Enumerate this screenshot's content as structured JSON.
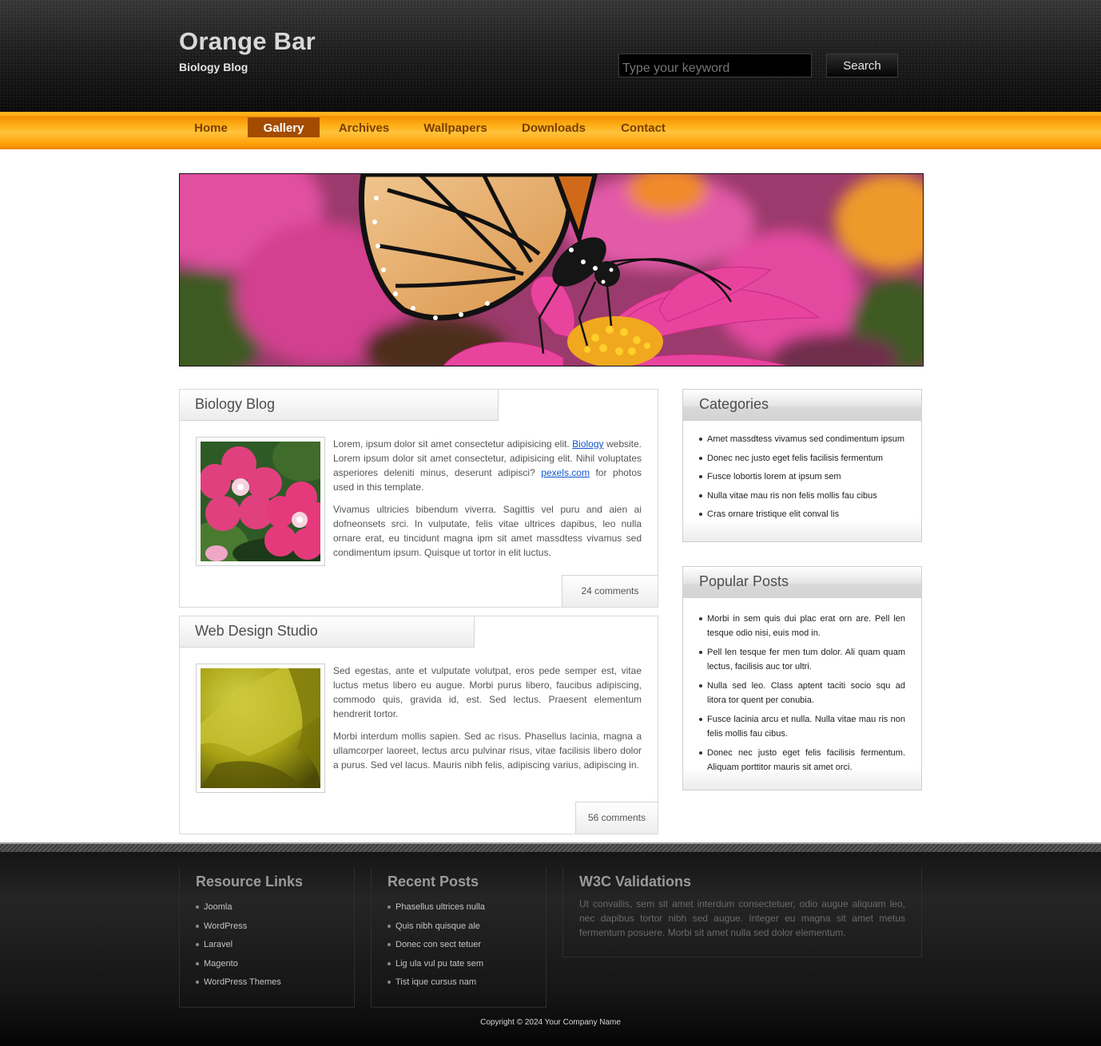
{
  "header": {
    "site_title": "Orange Bar",
    "tagline": "Biology Blog",
    "search_placeholder": "Type your keyword",
    "search_button": "Search"
  },
  "nav": {
    "items": [
      {
        "label": "Home",
        "active": false
      },
      {
        "label": "Gallery",
        "active": true
      },
      {
        "label": "Archives",
        "active": false
      },
      {
        "label": "Wallpapers",
        "active": false
      },
      {
        "label": "Downloads",
        "active": false
      },
      {
        "label": "Contact",
        "active": false
      }
    ]
  },
  "posts": [
    {
      "title": "Biology Blog",
      "p1_before": "Lorem, ipsum dolor sit amet consectetur adipisicing elit. ",
      "link1": "Biology",
      "p1_middle": " website. Lorem ipsum dolor sit amet consectetur, adipisicing elit. Nihil voluptates asperiores deleniti minus, deserunt adipisci? ",
      "link2": "pexels.com",
      "p1_after": " for photos used in this template.",
      "p2": "Vivamus ultricies bibendum viverra. Sagittis vel puru and aien ai dofneonsets srci. In vulputate, felis vitae ultrices dapibus, leo nulla ornare erat, eu tincidunt magna ipm sit amet massdtess vivamus sed condimentum ipsum. Quisque ut tortor in elit luctus.",
      "comments": "24 comments"
    },
    {
      "title": "Web Design Studio",
      "p1": "Sed egestas, ante et vulputate volutpat, eros pede semper est, vitae luctus metus libero eu augue. Morbi purus libero, faucibus adipiscing, commodo quis, gravida id, est. Sed lectus. Praesent elementum hendrerit tortor.",
      "p2": "Morbi interdum mollis sapien. Sed ac risus. Phasellus lacinia, magna a ullamcorper laoreet, lectus arcu pulvinar risus, vitae facilisis libero dolor a purus. Sed vel lacus. Mauris nibh felis, adipiscing varius, adipiscing in.",
      "comments": "56 comments"
    }
  ],
  "sidebar": {
    "categories": {
      "title": "Categories",
      "items": [
        "Amet massdtess vivamus sed condimentum ipsum",
        "Donec nec justo eget felis facilisis fermentum",
        "Fusce lobortis lorem at ipsum sem",
        "Nulla vitae mau ris non felis mollis fau cibus",
        "Cras ornare tristique elit conval lis"
      ]
    },
    "popular": {
      "title": "Popular Posts",
      "items": [
        "Morbi in sem quis dui plac erat orn are. Pell len tesque odio nisi, euis mod in.",
        "Pell len tesque fer men tum dolor. Ali quam quam lectus, facilisis auc tor ultri.",
        "Nulla sed leo. Class aptent taciti socio squ ad litora tor quent per conubia.",
        "Fusce lacinia arcu et nulla. Nulla vitae mau ris non felis mollis fau cibus.",
        "Donec nec justo eget felis facilisis fermentum. Aliquam porttitor mauris sit amet orci."
      ]
    }
  },
  "footer": {
    "resources": {
      "title": "Resource Links",
      "items": [
        "Joomla",
        "WordPress",
        "Laravel",
        "Magento",
        "WordPress Themes"
      ]
    },
    "recent": {
      "title": "Recent Posts",
      "items": [
        "Phasellus ultrices nulla",
        "Quis nibh quisque ale",
        "Donec con sect tetuer",
        "Lig ula vul pu tate sem",
        "Tist ique cursus nam"
      ]
    },
    "w3c": {
      "title": "W3C Validations",
      "text": "Ut convallis, sem sit amet interdum consectetuer, odio augue aliquam leo, nec dapibus tortor nibh sed augue. Integer eu magna sit amet metus fermentum posuere. Morbi sit amet nulla sed dolor elementum."
    },
    "copyright": "Copyright © 2024 Your Company Name"
  }
}
